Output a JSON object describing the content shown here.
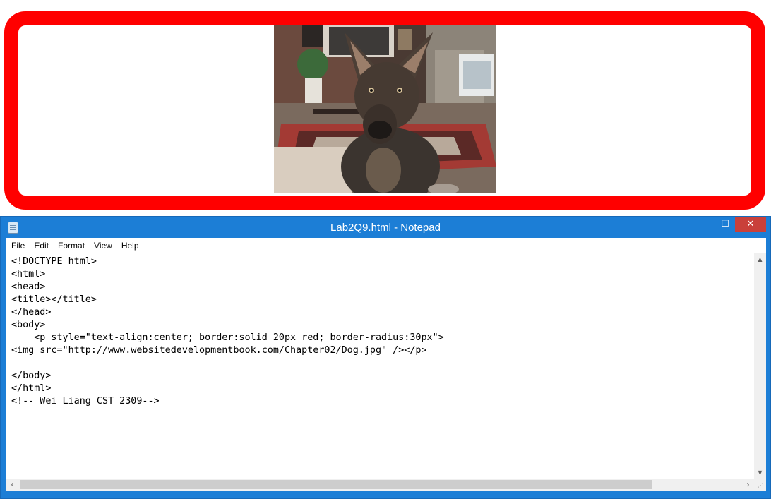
{
  "preview": {
    "image_alt": "dog photo",
    "border_color": "#ff0000"
  },
  "window": {
    "title": "Lab2Q9.html - Notepad",
    "minimize_glyph": "—",
    "maximize_glyph": "☐",
    "close_glyph": "✕"
  },
  "menu": {
    "items": [
      "File",
      "Edit",
      "Format",
      "View",
      "Help"
    ]
  },
  "editor": {
    "lines": [
      "<!DOCTYPE html>",
      "<html>",
      "<head>",
      "<title></title>",
      "</head>",
      "<body>",
      "    <p style=\"text-align:center; border:solid 20px red; border-radius:30px\">",
      "<img src=\"http://www.websitedevelopmentbook.com/Chapter02/Dog.jpg\" /></p>",
      "",
      "</body>",
      "</html>",
      "<!-- Wei Liang CST 2309-->"
    ]
  },
  "colors": {
    "titlebar": "#1c7ed6",
    "close_button": "#c9403a"
  },
  "icons": {
    "app": "notepad-icon",
    "scroll_up": "chevron-up-icon",
    "scroll_down": "chevron-down-icon",
    "scroll_left": "chevron-left-icon",
    "scroll_right": "chevron-right-icon"
  }
}
